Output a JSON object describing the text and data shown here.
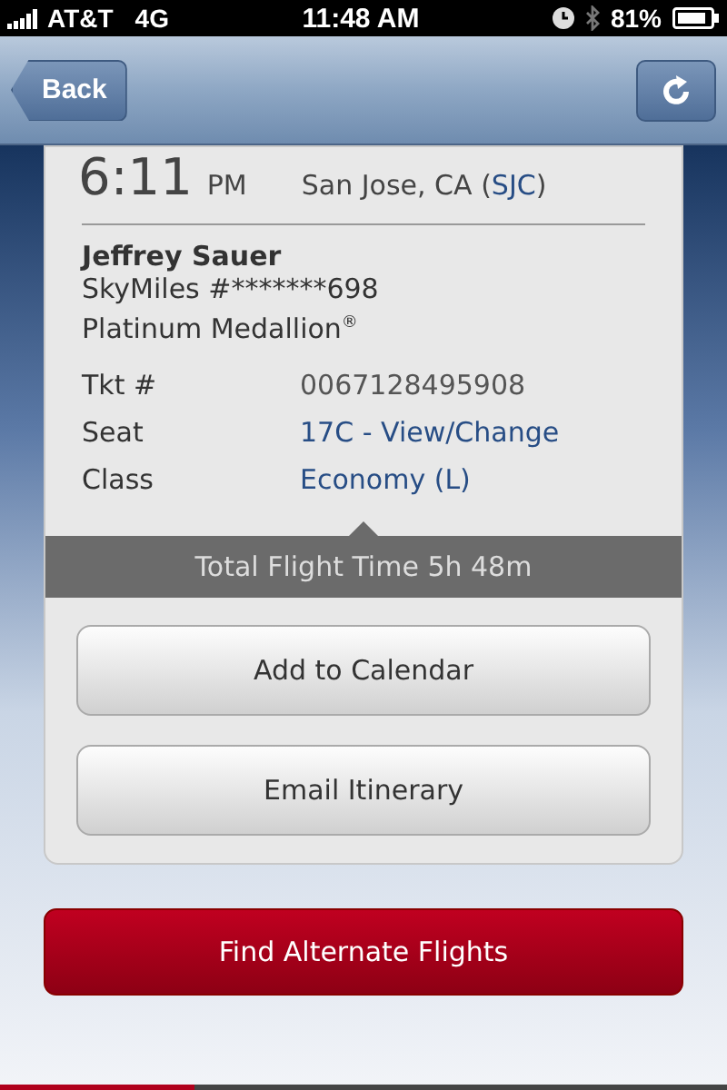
{
  "status_bar": {
    "carrier": "AT&T",
    "network": "4G",
    "time": "11:48 AM",
    "battery": "81%"
  },
  "nav_bar": {
    "back": "Back"
  },
  "arrival": {
    "time": "6:11",
    "meridiem": "PM",
    "city": "San Jose, CA (",
    "code": "SJC",
    "close": ")"
  },
  "passenger": {
    "name": "Jeffrey Sauer",
    "skymiles": "SkyMiles #*******698",
    "status": "Platinum Medallion$^{®}$"
  },
  "details": [
    {
      "label": "Tkt #",
      "value": "0067128495908",
      "kind": "plain"
    },
    {
      "label": "Seat",
      "value": "17C - View/Change",
      "kind": "link"
    },
    {
      "label": "Class",
      "value": "Economy (L)",
      "kind": "link"
    }
  ],
  "flight_time": "Total Flight Time 5h 48m",
  "actions": [
    "Add to Calendar",
    "Email Itinerary"
  ],
  "primary_action": "Find Alternate Flights"
}
